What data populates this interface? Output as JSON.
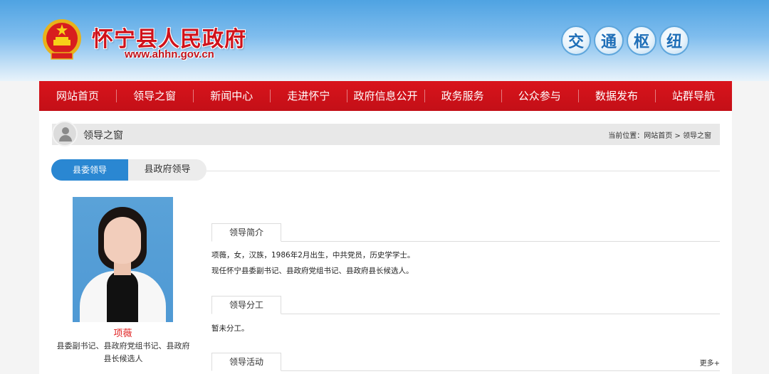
{
  "header": {
    "title": "怀宁县人民政府",
    "url": "www.ahhn.gov.cn",
    "slogan": [
      "交",
      "通",
      "枢",
      "纽"
    ]
  },
  "nav": {
    "items": [
      "网站首页",
      "领导之窗",
      "新闻中心",
      "走进怀宁",
      "政府信息公开",
      "政务服务",
      "公众参与",
      "数据发布",
      "站群导航"
    ]
  },
  "position_bar": {
    "title": "领导之窗",
    "breadcrumb": "当前位置：网站首页 > 领导之窗"
  },
  "tabs": {
    "active": "县委领导",
    "inactive": "县政府领导"
  },
  "leader": {
    "name": "项薇",
    "title": "县委副书记、县政府党组书记、县政府县长候选人"
  },
  "sections": {
    "intro": {
      "label": "领导简介",
      "line1": "项薇，女，汉族，1986年2月出生，中共党员，历史学学士。",
      "line2": "现任怀宁县委副书记、县政府党组书记、县政府县长候选人。"
    },
    "duty": {
      "label": "领导分工",
      "text": "暂未分工。"
    },
    "activity": {
      "label": "领导活动",
      "more": "更多+"
    }
  },
  "colors": {
    "nav_red": "#d0121b",
    "tab_blue": "#2a87d2",
    "name_red": "#e02020"
  }
}
